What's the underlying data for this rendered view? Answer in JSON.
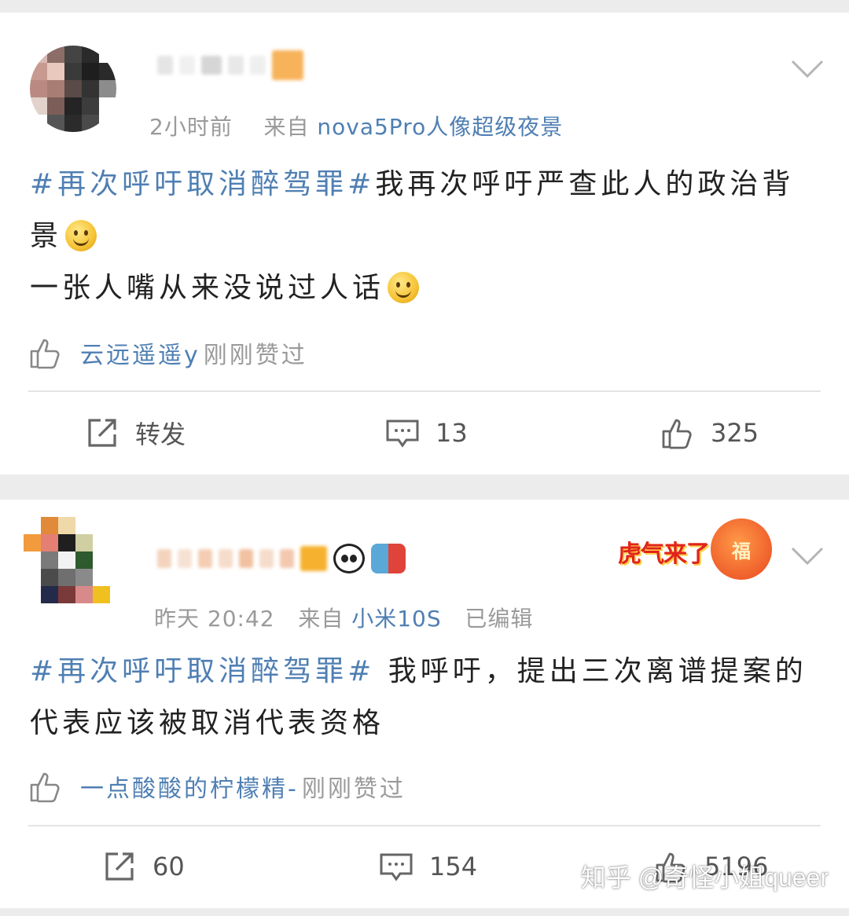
{
  "posts": [
    {
      "meta_time": "2小时前",
      "meta_from": "来自",
      "meta_source": "nova5Pro人像超级夜景",
      "meta_edited": "",
      "topic": "#再次呼吁取消醉驾罪#",
      "text_line1": "我再次呼吁严查此人的政治背景",
      "text_line2": "一张人嘴从来没说过人话",
      "liker": "云远遥遥y",
      "liked_text": "刚刚赞过",
      "repost_label": "转发",
      "comments": "13",
      "likes": "325"
    },
    {
      "meta_time": "昨天 20:42",
      "meta_from": "来自",
      "meta_source": "小米10S",
      "meta_edited": "已编辑",
      "topic": "#再次呼吁取消醉驾罪#",
      "text_line1": " 我呼吁，提出三次离谱提案的代表应该被取消代表资格",
      "text_line2": "",
      "liker": "一点酸酸的柠檬精-",
      "liked_text": "刚刚赞过",
      "repost_label": "60",
      "comments": "154",
      "likes": "5196",
      "badge_text": "虎气来了",
      "badge_icon_text": "福"
    }
  ],
  "watermark": "知乎 @奇怪小姐queer",
  "colors": {
    "topic_blue": "#4f7fb3",
    "meta_gray": "#9a9a9a",
    "background": "#ececec"
  },
  "icons": [
    "chevron-down-icon",
    "thumbs-up-icon",
    "share-icon",
    "comment-icon",
    "smile-emoji-icon",
    "panda-emoji-icon"
  ]
}
